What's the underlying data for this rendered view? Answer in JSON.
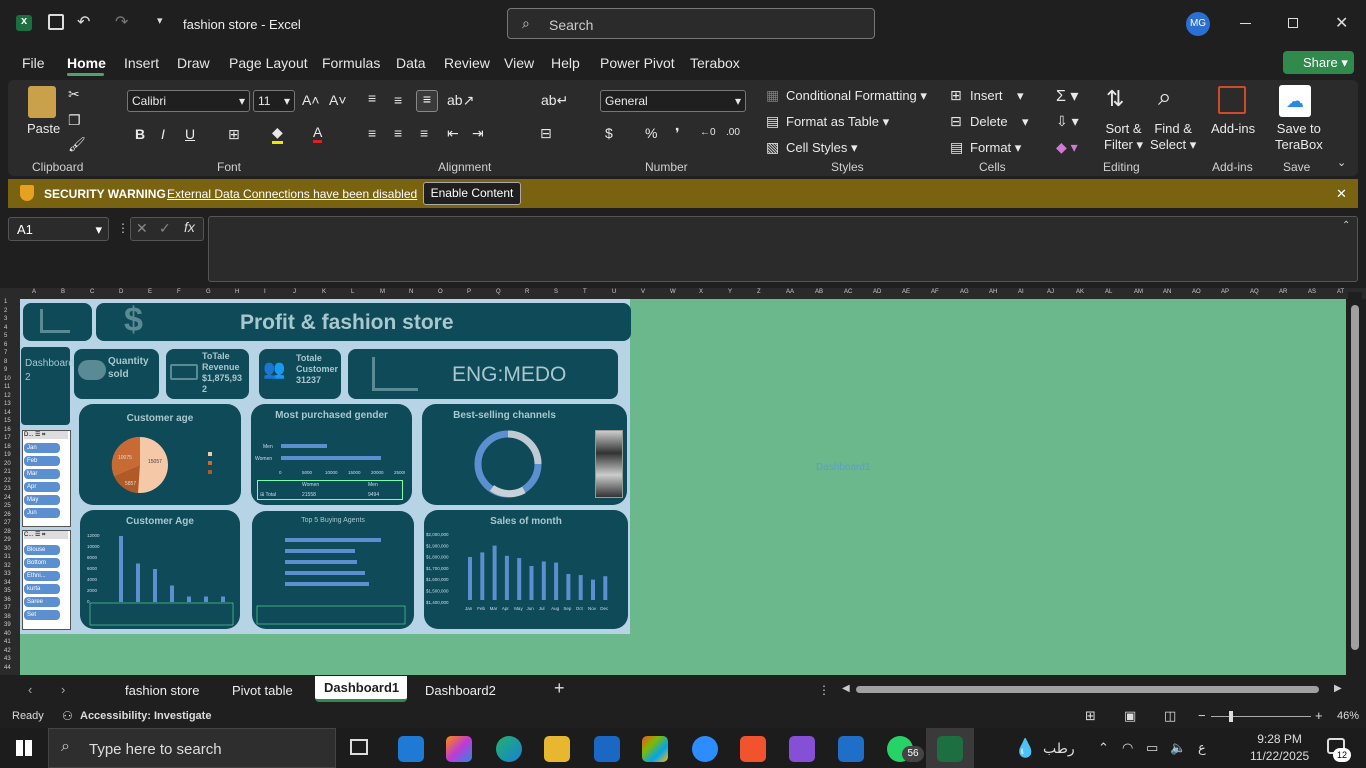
{
  "titlebar": {
    "filename": "fashion store",
    "app": "Excel",
    "separator": "-",
    "search_placeholder": "Search",
    "avatar": "MG"
  },
  "menu": [
    "File",
    "Home",
    "Insert",
    "Draw",
    "Page Layout",
    "Formulas",
    "Data",
    "Review",
    "View",
    "Help",
    "Power Pivot",
    "Terabox"
  ],
  "share_label": "Share",
  "ribbon": {
    "paste": "Paste",
    "font_name": "Calibri",
    "font_size": "11",
    "number_format": "General",
    "cond_format": "Conditional Formatting",
    "format_table": "Format as Table",
    "cell_styles": "Cell Styles",
    "insert": "Insert",
    "delete": "Delete",
    "format": "Format",
    "sort_filter_1": "Sort &",
    "sort_filter_2": "Filter",
    "find_select_1": "Find &",
    "find_select_2": "Select",
    "addins": "Add-ins",
    "terabox_1": "Save to",
    "terabox_2": "TeraBox",
    "groups": {
      "clipboard": "Clipboard",
      "font": "Font",
      "alignment": "Alignment",
      "number": "Number",
      "styles": "Styles",
      "cells": "Cells",
      "editing": "Editing",
      "addins": "Add-ins",
      "save": "Save"
    }
  },
  "warning": {
    "title": "SECURITY WARNING",
    "message": "External Data Connections have been disabled",
    "button": "Enable Content"
  },
  "namebox": "A1",
  "columns": [
    "A",
    "B",
    "C",
    "D",
    "E",
    "F",
    "G",
    "H",
    "I",
    "J",
    "K",
    "L",
    "M",
    "N",
    "O",
    "P",
    "Q",
    "R",
    "S",
    "T",
    "U",
    "V",
    "W",
    "X",
    "Y",
    "Z",
    "AA",
    "AB",
    "AC",
    "AD",
    "AE",
    "AF",
    "AG",
    "AH",
    "AI",
    "AJ",
    "AK",
    "AL",
    "AM",
    "AN",
    "AO",
    "AP",
    "AQ",
    "AR",
    "AS",
    "AT"
  ],
  "rows": [
    "1",
    "2",
    "3",
    "4",
    "5",
    "6",
    "7",
    "8",
    "9",
    "10",
    "11",
    "12",
    "13",
    "14",
    "15",
    "16",
    "17",
    "18",
    "19",
    "20",
    "21",
    "22",
    "23",
    "24",
    "25",
    "26",
    "27",
    "28",
    "29",
    "30",
    "31",
    "32",
    "33",
    "34",
    "35",
    "36",
    "37",
    "38",
    "39",
    "40",
    "41",
    "42",
    "43",
    "44"
  ],
  "dashboard": {
    "title": "Profit & fashion store",
    "nav": "Dashboard 2",
    "kpi_qty": "Quantity sold",
    "kpi_rev_1": "ToTale",
    "kpi_rev_2": "Revenue",
    "kpi_rev_3": "$1,875,93",
    "kpi_rev_4": "2",
    "kpi_cust_1": "Totale",
    "kpi_cust_2": "Customer",
    "kpi_cust_3": "31237",
    "author": "ENG:MEDO",
    "chart1_title": "Customer age",
    "chart2_title": "Most purchased gender",
    "chart3_title": "Best-selling channels",
    "chart4_title": "Customer Age",
    "chart5_title": "Top 5 Buying Agents",
    "chart6_title": "Sales of month",
    "slicer1": [
      "Jan",
      "Feb",
      "Mar",
      "Apr",
      "May",
      "Jun"
    ],
    "slicer2": [
      "Blouse",
      "Bottom",
      "Ethni...",
      "kurta",
      "Saree",
      "Set"
    ],
    "gender_labels": [
      "Men",
      "Women"
    ],
    "gender_axis": [
      "0",
      "5000",
      "10000",
      "15000",
      "20000",
      "25000"
    ],
    "gender_table": [
      "Women",
      "Men",
      "21558",
      "9494"
    ],
    "sales_axis": [
      "$2,000,000",
      "$1,900,000",
      "$1,800,000",
      "$1,700,000",
      "$1,600,000",
      "$1,500,000",
      "$1,400,000"
    ],
    "months": [
      "Jan",
      "Feb",
      "Mar",
      "Apr",
      "May",
      "Jun",
      "Jul",
      "Aug",
      "Sep",
      "Oct",
      "Nov",
      "Dec"
    ],
    "age_axis": [
      "12000",
      "10000",
      "8000",
      "6000",
      "4000",
      "2000",
      "0"
    ],
    "pie_labels": [
      "15057",
      "10075",
      "5857"
    ],
    "watermark_cell": "Dashboard1"
  },
  "sheets": [
    "fashion store",
    "Pivot table",
    "Dashboard1",
    "Dashboard2"
  ],
  "status": {
    "ready": "Ready",
    "accessibility": "Accessibility: Investigate",
    "zoom": "46%"
  },
  "taskbar": {
    "search": "Type here to search",
    "time": "9:28 PM",
    "date": "11/22/2025",
    "weather": "رطب",
    "badge": "56",
    "notif": "12"
  }
}
